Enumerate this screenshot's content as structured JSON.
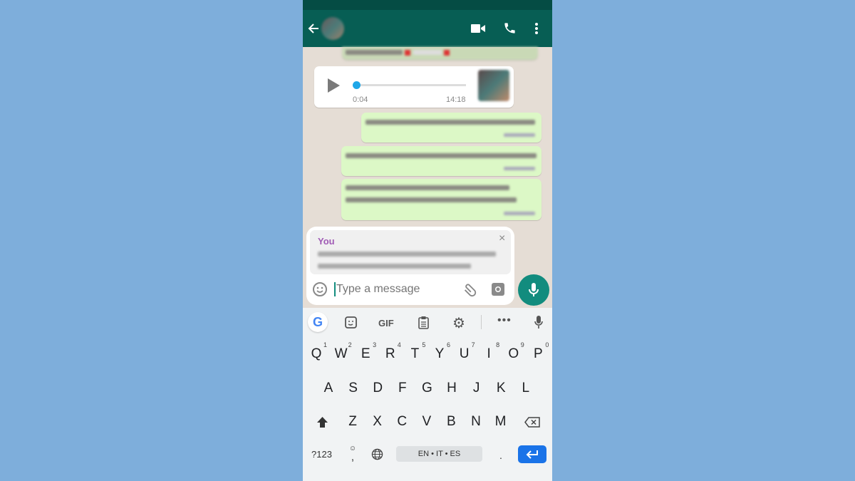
{
  "header": {
    "contact_name": "",
    "icons": [
      "back-arrow-icon",
      "video-call-icon",
      "phone-icon",
      "more-vert-icon"
    ]
  },
  "voice_message": {
    "elapsed": "0:04",
    "time": "14:18",
    "progress": 0.0,
    "accent": "#1fa7e8"
  },
  "reply_preview": {
    "author": "You",
    "author_color": "#a05bb5"
  },
  "composer": {
    "placeholder": "Type a message"
  },
  "keyboard": {
    "toolbar": [
      "google-icon",
      "sticker-icon",
      "GIF",
      "clipboard-icon",
      "gear-icon",
      "more-icon",
      "mic-icon"
    ],
    "gif_label": "GIF",
    "row1": [
      {
        "k": "Q",
        "n": "1"
      },
      {
        "k": "W",
        "n": "2"
      },
      {
        "k": "E",
        "n": "3"
      },
      {
        "k": "R",
        "n": "4"
      },
      {
        "k": "T",
        "n": "5"
      },
      {
        "k": "Y",
        "n": "6"
      },
      {
        "k": "U",
        "n": "7"
      },
      {
        "k": "I",
        "n": "8"
      },
      {
        "k": "O",
        "n": "9"
      },
      {
        "k": "P",
        "n": "0"
      }
    ],
    "row2": [
      "A",
      "S",
      "D",
      "F",
      "G",
      "H",
      "J",
      "K",
      "L"
    ],
    "row3": [
      "Z",
      "X",
      "C",
      "V",
      "B",
      "N",
      "M"
    ],
    "symbols_label": "?123",
    "comma_label": ",",
    "space_label": "EN • IT • ES",
    "period_label": ".",
    "enter_color": "#1a73e8"
  },
  "colors": {
    "header": "#075e54",
    "send_button": "#128c7e",
    "chat_bg": "#e5ddd5",
    "outgoing": "#dcf8c6"
  }
}
